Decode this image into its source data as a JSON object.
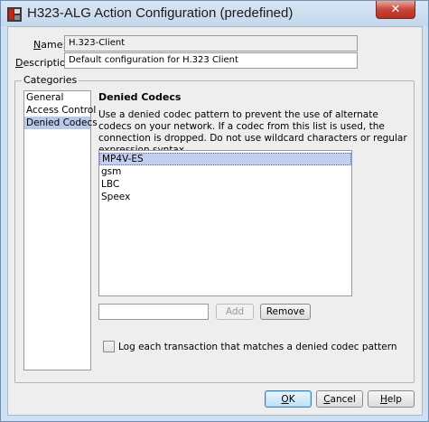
{
  "window": {
    "title": "H323-ALG Action Configuration (predefined)",
    "close_glyph": "✕",
    "icon": "app-icon",
    "accent_color": "#c7463a"
  },
  "form": {
    "name_label": "Name:",
    "name_value": "H.323-Client",
    "description_label": "Description:",
    "description_value": "Default configuration for H.323 Client"
  },
  "categories": {
    "legend": "Categories",
    "items": [
      {
        "label": "General",
        "selected": false
      },
      {
        "label": "Access Control",
        "selected": false
      },
      {
        "label": "Denied Codecs",
        "selected": true
      }
    ]
  },
  "denied_codecs": {
    "title": "Denied Codecs",
    "description": "Use a denied codec pattern to prevent the use of alternate codecs on your network. If a codec from this list is used, the connection is dropped. Do not use wildcard characters or regular expression syntax.",
    "codecs": [
      {
        "label": "MP4V-ES",
        "selected": true
      },
      {
        "label": "gsm",
        "selected": false
      },
      {
        "label": "LBC",
        "selected": false
      },
      {
        "label": "Speex",
        "selected": false
      }
    ],
    "new_codec_value": "",
    "add_label": "Add",
    "remove_label": "Remove",
    "log_label": "Log each transaction that matches a denied codec pattern",
    "log_checked": false
  },
  "footer": {
    "ok_label": "OK",
    "cancel_label": "Cancel",
    "help_label": "Help"
  }
}
